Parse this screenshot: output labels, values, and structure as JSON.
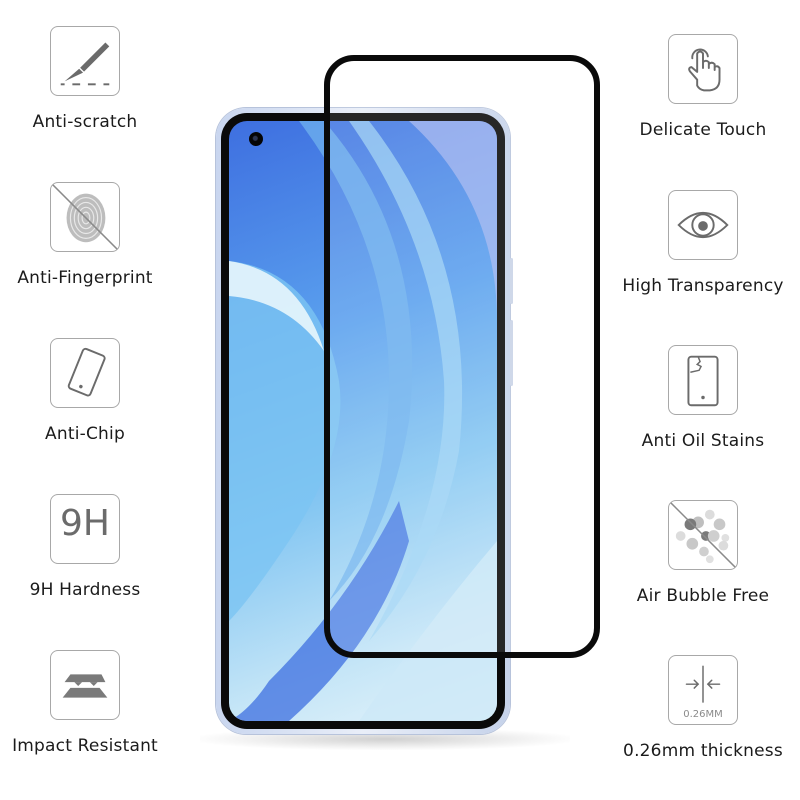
{
  "features_left": [
    {
      "label": "Anti-scratch",
      "icon": "scalpel-icon"
    },
    {
      "label": "Anti-Fingerprint",
      "icon": "fingerprint-crossed-icon"
    },
    {
      "label": "Anti-Chip",
      "icon": "phone-tilted-icon"
    },
    {
      "label": "9H Hardness",
      "icon": "9h-icon",
      "icon_text": "9H"
    },
    {
      "label": "Impact Resistant",
      "icon": "layers-impact-icon"
    }
  ],
  "features_right": [
    {
      "label": "Delicate Touch",
      "icon": "touch-hand-icon"
    },
    {
      "label": "High Transparency",
      "icon": "eye-icon"
    },
    {
      "label": "Anti Oil Stains",
      "icon": "phone-oil-stain-icon"
    },
    {
      "label": "Air Bubble Free",
      "icon": "bubbles-crossed-icon"
    },
    {
      "label": "0.26mm thickness",
      "icon": "thickness-arrows-icon",
      "icon_text": "0.26MM"
    }
  ],
  "colors": {
    "protector_border": "#0a0a0a",
    "icon_stroke": "#6b6b6b",
    "icon_border": "#a8a8a8",
    "phone_frame": "#dbe4f4",
    "screen_blue": "#4f8fe8"
  }
}
